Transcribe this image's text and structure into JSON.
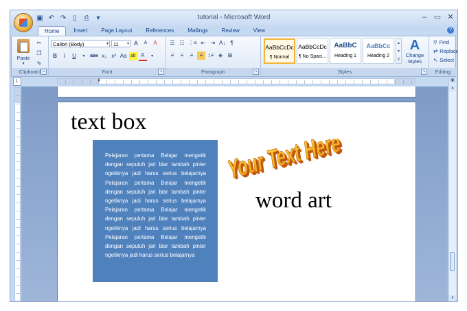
{
  "window": {
    "title": "tutorial - Microsoft Word"
  },
  "quick_access": [
    "save-icon",
    "undo-icon",
    "redo-icon",
    "new-icon",
    "print-preview-icon",
    "customize-icon"
  ],
  "tabs": [
    {
      "label": "Home",
      "active": true
    },
    {
      "label": "Insert"
    },
    {
      "label": "Page Layout"
    },
    {
      "label": "References"
    },
    {
      "label": "Mailings"
    },
    {
      "label": "Review"
    },
    {
      "label": "View"
    }
  ],
  "ribbon": {
    "clipboard": {
      "label": "Clipboard",
      "paste": "Paste"
    },
    "font": {
      "label": "Font",
      "family": "Calibri (Body)",
      "size": "11",
      "bold": "B",
      "italic": "I",
      "underline": "U",
      "strike": "abe",
      "subscript": "x₂",
      "superscript": "x²",
      "change_case": "Aa",
      "grow": "A",
      "shrink": "A",
      "clear": "A",
      "highlight": "ab",
      "color": "A"
    },
    "paragraph": {
      "label": "Paragraph",
      "sort": "A↓",
      "marks": "¶"
    },
    "styles": {
      "label": "Styles",
      "items": [
        {
          "sample": "AaBbCcDc",
          "name": "¶ Normal",
          "selected": true
        },
        {
          "sample": "AaBbCcDc",
          "name": "¶ No Spaci..."
        },
        {
          "sample": "AaBbC",
          "name": "Heading 1"
        },
        {
          "sample": "AaBbCc",
          "name": "Heading 2"
        }
      ],
      "change_styles_line1": "Change",
      "change_styles_line2": "Styles"
    },
    "editing": {
      "label": "Editing",
      "find": "Find",
      "replace": "Replace",
      "select": "Select"
    }
  },
  "ruler": {
    "corner": "L"
  },
  "document": {
    "heading": "text box",
    "text_box_body": "Pelajaran pertama Belajar mengetik dengan sepuluh jari biar tambah pinter ngetiknya jadi harus serius belajarnya Pelajaran pertama Belajar mengetik dengan sepuluh jari biar tambah pinter ngetiknya jadi harus serius belajarnya Pelajaran pertama Belajar mengetik dengan sepuluh jari biar tambah pinter ngetiknya jadi harus serius belajarnya Pelajaran pertama Belajar mengetik dengan sepuluh jari biar tambah pinter ngetiknya jadi harus serius belajarnya",
    "text_box_color": "#4f81bd",
    "wordart_text": "Your Text Here",
    "wordart_colors": {
      "front": "#f7b21a",
      "side": "#c0560c"
    },
    "wordart_label": "word art"
  }
}
